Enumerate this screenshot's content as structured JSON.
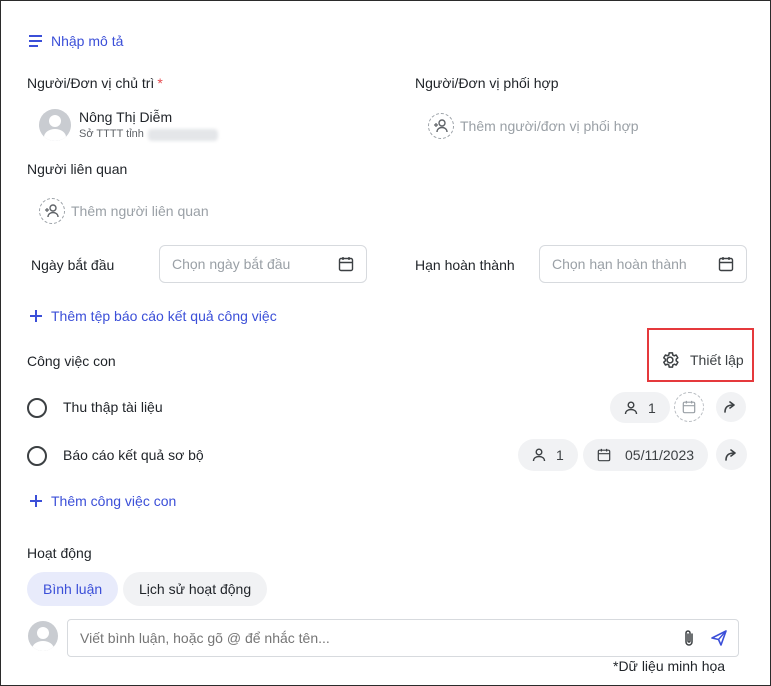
{
  "description_link": "Nhập mô tả",
  "owner": {
    "label": "Người/Đơn vị chủ trì",
    "required_mark": "*",
    "name": "Nông Thị Diễm",
    "org": "Sở TTTT tỉnh"
  },
  "coordinator": {
    "label": "Người/Đơn vị phối hợp",
    "placeholder": "Thêm người/đơn vị phối hợp"
  },
  "related": {
    "label": "Người liên quan",
    "placeholder": "Thêm người liên quan"
  },
  "start_date": {
    "label": "Ngày bắt đầu",
    "placeholder": "Chọn ngày bắt đầu"
  },
  "due_date": {
    "label": "Hạn hoàn thành",
    "placeholder": "Chọn hạn hoàn thành"
  },
  "add_report_file": "Thêm tệp báo cáo kết quả công việc",
  "subtasks": {
    "title": "Công việc con",
    "settings_label": "Thiết lập",
    "items": [
      {
        "title": "Thu thập tài liệu",
        "assignees": "1",
        "date": ""
      },
      {
        "title": "Báo cáo kết quả sơ bộ",
        "assignees": "1",
        "date": "05/11/2023"
      }
    ],
    "add_label": "Thêm công việc con"
  },
  "activity": {
    "title": "Hoạt động",
    "tabs": [
      {
        "label": "Bình luận",
        "active": true
      },
      {
        "label": "Lịch sử hoạt động",
        "active": false
      }
    ],
    "comment_placeholder": "Viết bình luận, hoặc gõ @ để nhắc tên..."
  },
  "footnote": "*Dữ liệu minh họa",
  "colors": {
    "accent": "#3b4fd8",
    "highlight_box": "#e5393c",
    "required": "#e5484d"
  }
}
